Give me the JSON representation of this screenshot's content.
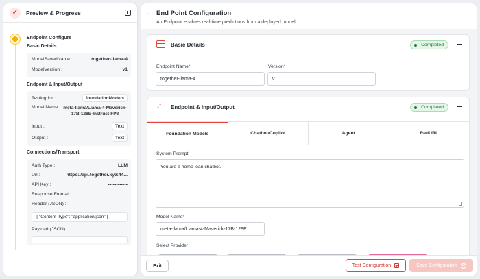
{
  "sidebar": {
    "title": "Preview & Progress",
    "step": "Endpoint Configure",
    "basic": {
      "title": "Basic Details",
      "rows": [
        {
          "key": "ModelSavedName :",
          "value": "together-llama-4"
        },
        {
          "key": "ModelVersion :",
          "value": "v1"
        }
      ]
    },
    "io": {
      "title": "Endpoint & Input/Output",
      "testing_key": "Testing for :",
      "testing_value": "foundationModels",
      "model_key": "Model Name :",
      "model_value": "meta-llama/Llama-4-Maverick-17B-128E-Instruct-FP8",
      "input_key": "Input :",
      "input_value": "Text",
      "output_key": "Output :",
      "output_value": "Text"
    },
    "conn": {
      "title": "Connections/Transport",
      "auth_key": "Auth Type :",
      "auth_value": "LLM",
      "url_key": "Url :",
      "url_value": "https://api.together.xyz:44...",
      "apikey_key": "API Key :",
      "apikey_value": "••••••••••••",
      "response_key": "Response Fromat :",
      "header_key": "Header (JSON) :",
      "header_value": "{ \"Content-Type\": \"application/json\" }",
      "payload_key": "Payload (JSON) :"
    }
  },
  "main": {
    "back": "←",
    "title": "End Point Configuration",
    "subtitle": "An Endpoint enables real-time predictions from a deployed model.",
    "basic": {
      "title": "Basic Details",
      "status": "Completed",
      "endpoint_label": "Endpoint Name",
      "endpoint_value": "together-llama-4",
      "version_label": "Version",
      "version_value": "v1",
      "required": "*"
    },
    "io": {
      "title": "Endpoint & Input/Output",
      "status": "Completed",
      "tabs": [
        "Foundation Models",
        "Chatbot/Copilot",
        "Agent",
        "RedURL"
      ],
      "system_prompt_label": "System Prompt:",
      "system_prompt_value": "You are a home loan chatbot.",
      "model_name_label": "Model Name",
      "model_name_value": "meta-llama/Llama-4-Maverick-17B-128E",
      "provider_label": "Select Provider"
    },
    "footer": {
      "exit": "Exit",
      "test": "Test Configuration",
      "save": "Save Configuration"
    }
  },
  "colors": {
    "accent": "#e0453a",
    "status_green": "#1e7a3a",
    "step_active": "#f0b400"
  }
}
